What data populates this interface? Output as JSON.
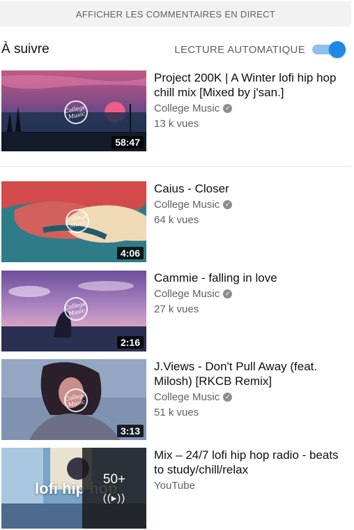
{
  "live_chat": {
    "label": "AFFICHER LES COMMENTAIRES EN DIRECT"
  },
  "up_next": {
    "title": "À suivre",
    "autoplay_label": "LECTURE AUTOMATIQUE",
    "autoplay_enabled": true
  },
  "videos": [
    {
      "title": "Project 200K | A Winter lofi hip hop chill mix [Mixed by j'san.]",
      "channel": "College Music",
      "verified": true,
      "views": "13 k vues",
      "duration": "58:47",
      "logo_text": "College Music"
    },
    {
      "title": "Caius - Closer",
      "channel": "College Music",
      "verified": true,
      "views": "64 k vues",
      "duration": "4:06",
      "logo_text": "College Music"
    },
    {
      "title": "Cammie - falling in love",
      "channel": "College Music",
      "verified": true,
      "views": "27 k vues",
      "duration": "2:16",
      "logo_text": "College Music"
    },
    {
      "title": "J.Views - Don't Pull Away (feat. Milosh) [RKCB Remix]",
      "channel": "College Music",
      "verified": true,
      "views": "51 k vues",
      "duration": "3:13",
      "logo_text": "College Music"
    }
  ],
  "mix": {
    "title": "Mix – 24/7 lofi hip hop radio - beats to study/chill/relax",
    "channel": "YouTube",
    "count": "50+",
    "thumb_text": "lofi hip hop",
    "icon": "broadcast-icon"
  }
}
